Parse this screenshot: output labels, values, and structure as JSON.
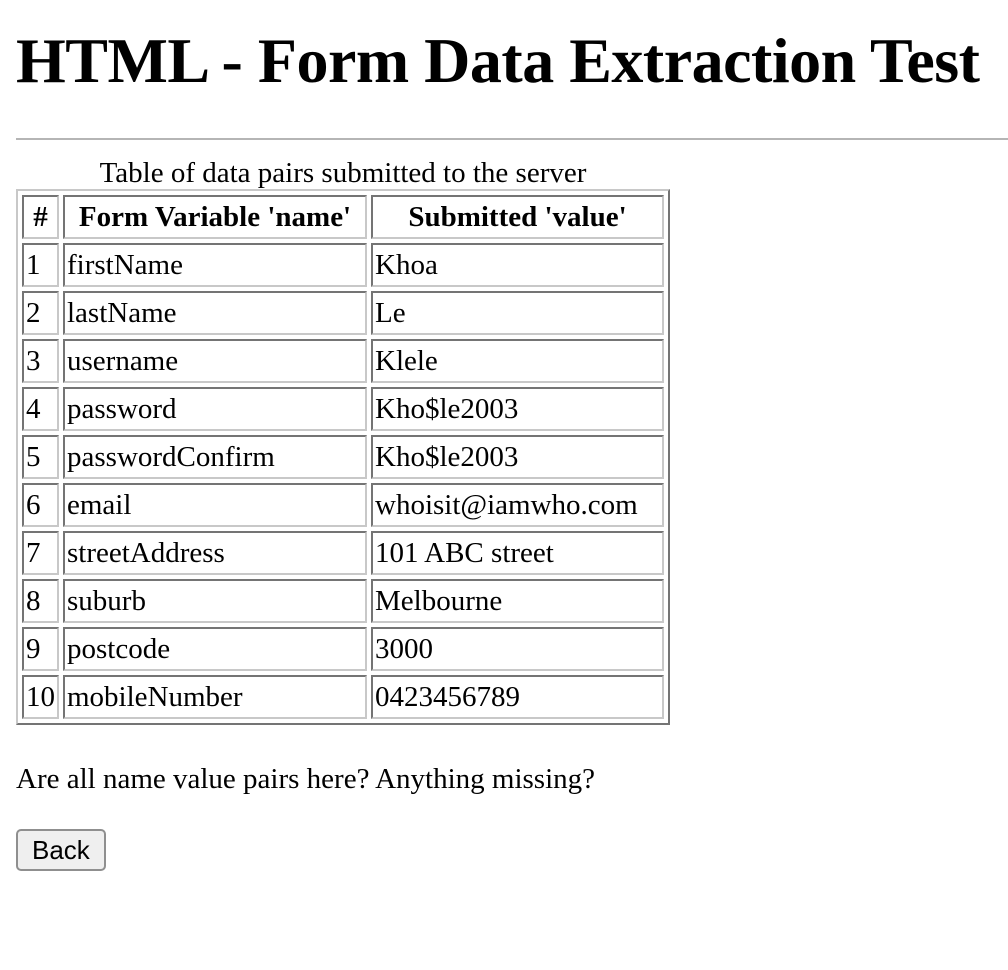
{
  "page": {
    "title": "HTML - Form Data Extraction Test"
  },
  "table": {
    "caption": "Table of data pairs submitted to the server",
    "headers": [
      "#",
      "Form Variable 'name'",
      "Submitted 'value'"
    ],
    "rows": [
      [
        "1",
        "firstName",
        "Khoa"
      ],
      [
        "2",
        "lastName",
        "Le"
      ],
      [
        "3",
        "username",
        "Klele"
      ],
      [
        "4",
        "password",
        "Kho$le2003"
      ],
      [
        "5",
        "passwordConfirm",
        "Kho$le2003"
      ],
      [
        "6",
        "email",
        "whoisit@iamwho.com"
      ],
      [
        "7",
        "streetAddress",
        "101 ABC street"
      ],
      [
        "8",
        "suburb",
        "Melbourne"
      ],
      [
        "9",
        "postcode",
        "3000"
      ],
      [
        "10",
        "mobileNumber",
        "0423456789"
      ]
    ]
  },
  "question": "Are all name value pairs here? Anything missing?",
  "back_button": {
    "label": "Back"
  }
}
